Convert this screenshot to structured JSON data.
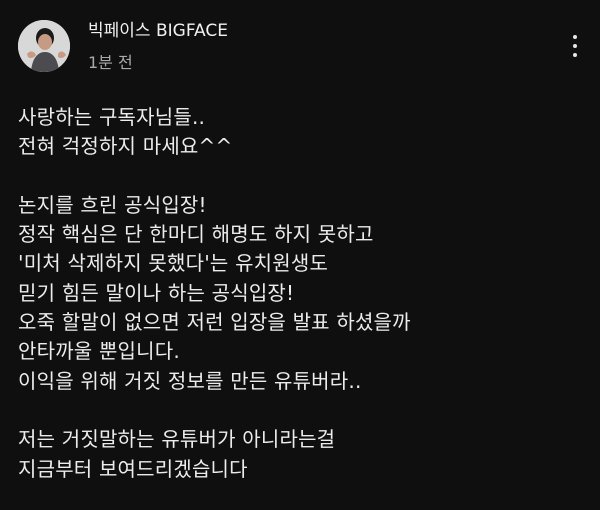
{
  "post": {
    "channel_name": "빅페이스 BIGFACE",
    "timestamp": "1분 전",
    "avatar_icon": "avatar-icon",
    "more_icon": "more-vert-icon",
    "lines": [
      "사랑하는 구독자님들..",
      "전혀 걱정하지 마세요^^",
      "",
      "논지를 흐린 공식입장!",
      "정작 핵심은 단 한마디 해명도 하지 못하고",
      "'미처 삭제하지 못했다'는 유치원생도",
      "믿기 힘든 말이나 하는 공식입장!",
      "오죽 할말이 없으면 저런 입장을 발표 하셨을까",
      "안타까울 뿐입니다.",
      "이익을 위해 거짓 정보를 만든 유튜버라..",
      "",
      "저는 거짓말하는 유튜버가 아니라는걸",
      "지금부터 보여드리겠습니다"
    ]
  },
  "colors": {
    "background": "#0f0f0f",
    "text_primary": "#f1f1f1",
    "text_secondary": "#aaaaaa"
  }
}
